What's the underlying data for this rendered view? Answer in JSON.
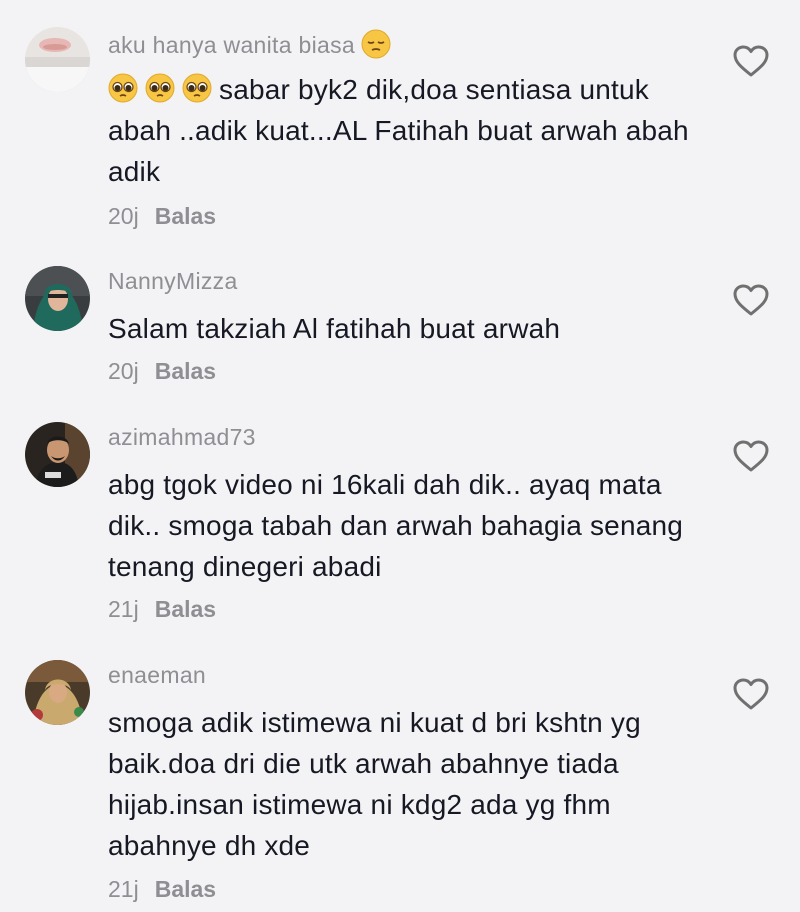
{
  "comments": [
    {
      "username": "aku hanya wanita biasa",
      "text": "sabar byk2 dik,doa sentiasa untuk abah ..adik kuat...AL Fatihah buat arwah abah adik",
      "time": "20j",
      "reply_label": "Balas",
      "username_emoji": "pensive-face",
      "leading_emojis": [
        "pleading-face",
        "pleading-face",
        "pleading-face"
      ]
    },
    {
      "username": "NannyMizza",
      "text": "Salam takziah Al fatihah buat arwah",
      "time": "20j",
      "reply_label": "Balas"
    },
    {
      "username": "azimahmad73",
      "text": "abg tgok video ni 16kali dah dik.. ayaq mata dik.. smoga tabah dan arwah bahagia senang tenang dinegeri abadi",
      "time": "21j",
      "reply_label": "Balas"
    },
    {
      "username": "enaeman",
      "text": "smoga adik istimewa ni kuat d bri kshtn yg baik.doa dri die utk arwah abahnye tiada hijab.insan istimewa ni kdg2 ada yg fhm abahnye dh xde",
      "time": "21j",
      "reply_label": "Balas"
    }
  ],
  "colors": {
    "background": "#f3f3f5",
    "text": "#161823",
    "muted": "#8e8e93",
    "like_outline": "#707070"
  },
  "icons": {
    "like": "heart-outline-icon"
  }
}
